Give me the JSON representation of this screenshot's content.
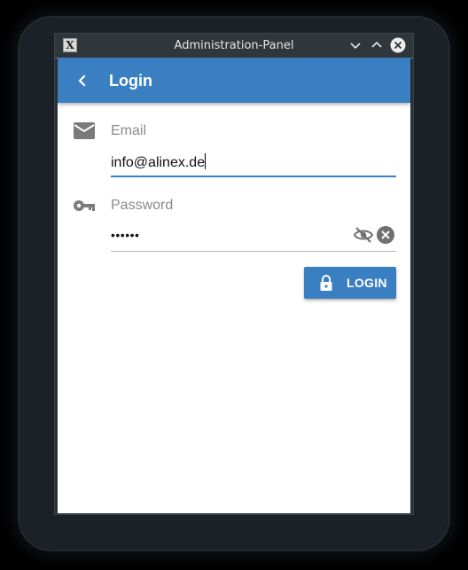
{
  "window": {
    "title": "Administration-Panel",
    "app_icon": "X",
    "controls": [
      "minimize-icon",
      "maximize-icon",
      "close-icon"
    ]
  },
  "appbar": {
    "title": "Login",
    "back_icon": "chevron-left-icon"
  },
  "form": {
    "email": {
      "icon": "envelope-icon",
      "label": "Email",
      "value": "info@alinex.de"
    },
    "password": {
      "icon": "key-icon",
      "label": "Password",
      "value": "••••••",
      "toggle_icon": "eye-off-icon",
      "clear_icon": "clear-icon"
    },
    "submit": {
      "icon": "lock-icon",
      "label": "LOGIN"
    }
  },
  "colors": {
    "primary": "#3a7fc1",
    "window_frame": "#2b3238",
    "label_grey": "#8a8a8a"
  }
}
